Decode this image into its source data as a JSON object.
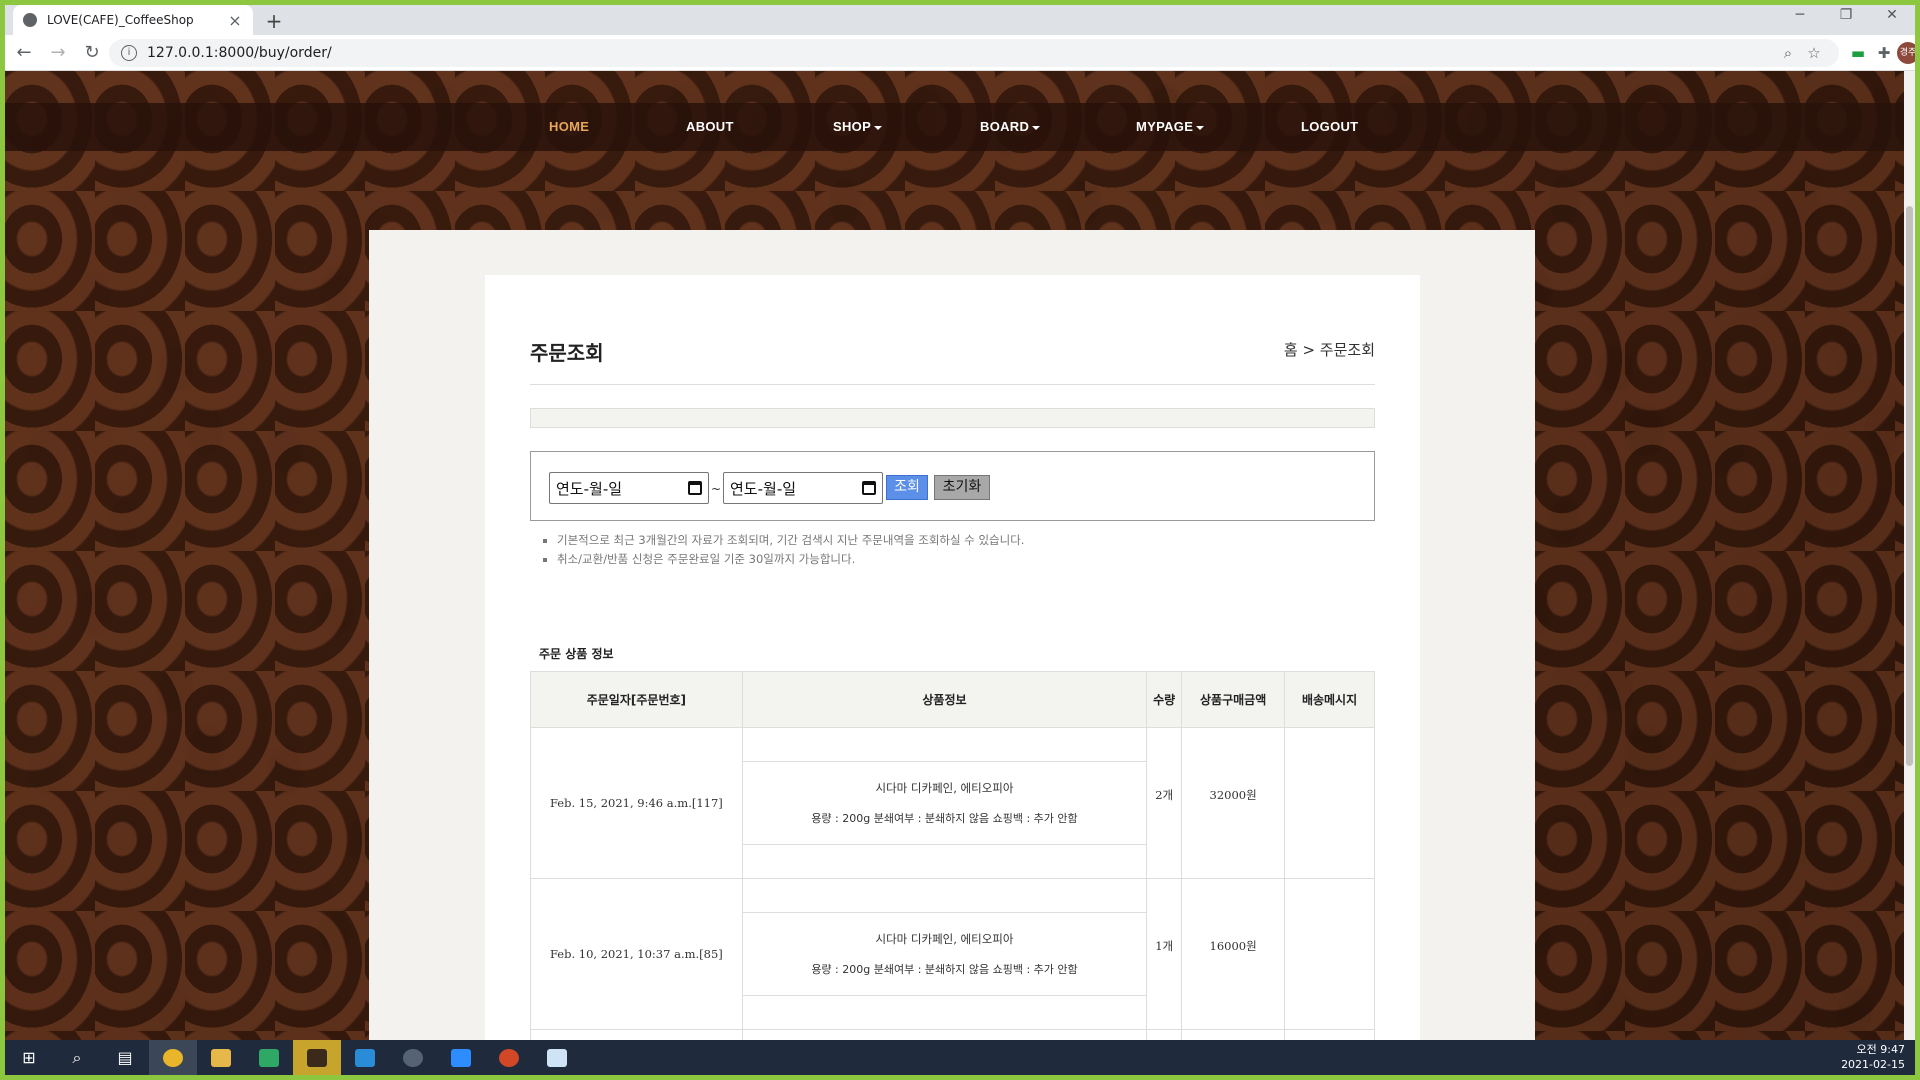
{
  "browser": {
    "tab_title": "LOVE(CAFE)_CoffeeShop",
    "tab_close": "×",
    "new_tab": "+",
    "url": "127.0.0.1:8000/buy/order/",
    "avatar_text": "경주"
  },
  "nav": {
    "items": [
      {
        "label": "HOME",
        "active": true
      },
      {
        "label": "ABOUT"
      },
      {
        "label": "SHOP",
        "dropdown": true
      },
      {
        "label": "BOARD",
        "dropdown": true
      },
      {
        "label": "MYPAGE",
        "dropdown": true
      },
      {
        "label": "LOGOUT"
      }
    ]
  },
  "page": {
    "title": "주문조회",
    "breadcrumb": "홈 > 주문조회"
  },
  "search": {
    "from_placeholder": "연도-월-일",
    "to_placeholder": "연도-월-일",
    "tilde": "~",
    "search_label": "조회",
    "reset_label": "초기화"
  },
  "notes": [
    "기본적으로 최근 3개월간의 자료가 조회되며, 기간 검색시 지난 주문내역을 조회하실 수 있습니다.",
    "취소/교환/반품 신청은 주문완료일 기준 30일까지 가능합니다."
  ],
  "orders": {
    "section_title": "주문 상품 정보",
    "headers": [
      "주문일자[주문번호]",
      "상품정보",
      "수량",
      "상품구매금액",
      "배송메시지"
    ],
    "rows": [
      {
        "date": "Feb. 15, 2021, 9:46 a.m.[117]",
        "product": "시다마 디카페인, 에티오피아",
        "options": "용량 : 200g 분쇄여부 : 분쇄하지 않음 쇼핑백 : 추가 안함",
        "qty": "2개",
        "price": "32000원",
        "message": ""
      },
      {
        "date": "Feb. 10, 2021, 10:37 a.m.[85]",
        "product": "시다마 디카페인, 에티오피아",
        "options": "용량 : 200g 분쇄여부 : 분쇄하지 않음 쇼핑백 : 추가 안함",
        "qty": "1개",
        "price": "16000원",
        "message": ""
      }
    ]
  },
  "taskbar": {
    "time": "오전 9:47",
    "date": "2021-02-15"
  }
}
